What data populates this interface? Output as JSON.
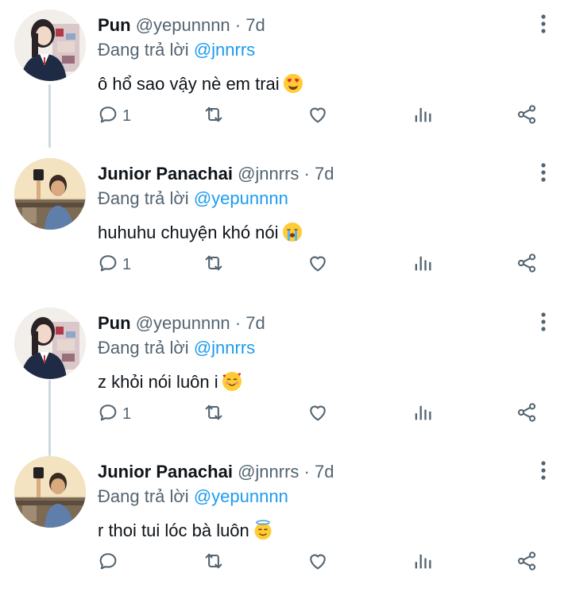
{
  "tweets": [
    {
      "avatar": "girl-avatar",
      "name": "Pun",
      "handle": "@yepunnnn",
      "separator": "·",
      "time": "7d",
      "replying_prefix": "Đang trả lời",
      "replying_to": "@jnnrrs",
      "text": "ô hổ sao vậy nè em trai",
      "emoji": "heart-eyes-emoji",
      "reply_count": "1"
    },
    {
      "avatar": "boy-avatar",
      "name": "Junior Panachai",
      "handle": "@jnnrrs",
      "separator": "·",
      "time": "7d",
      "replying_prefix": "Đang trả lời",
      "replying_to": "@yepunnnn",
      "text": "huhuhu chuyện khó nói",
      "emoji": "loudly-crying-emoji",
      "reply_count": "1"
    },
    {
      "avatar": "girl-avatar",
      "name": "Pun",
      "handle": "@yepunnnn",
      "separator": "·",
      "time": "7d",
      "replying_prefix": "Đang trả lời",
      "replying_to": "@jnnrrs",
      "text": "z khỏi nói luôn i",
      "emoji": "smiling-hearts-emoji",
      "reply_count": "1"
    },
    {
      "avatar": "boy-avatar",
      "name": "Junior Panachai",
      "handle": "@jnnrrs",
      "separator": "·",
      "time": "7d",
      "replying_prefix": "Đang trả lời",
      "replying_to": "@yepunnnn",
      "text": "r thoi tui lóc bà luôn",
      "emoji": "halo-emoji",
      "reply_count": ""
    }
  ],
  "icons": {
    "reply": "reply-icon",
    "retweet": "retweet-icon",
    "like": "heart-icon",
    "views": "bar-chart-icon",
    "share": "share-icon",
    "more": "more-vertical-icon"
  },
  "colors": {
    "text": "#0f1419",
    "secondary": "#536471",
    "link": "#1d9bf0",
    "thread_line": "#cfd9de"
  }
}
